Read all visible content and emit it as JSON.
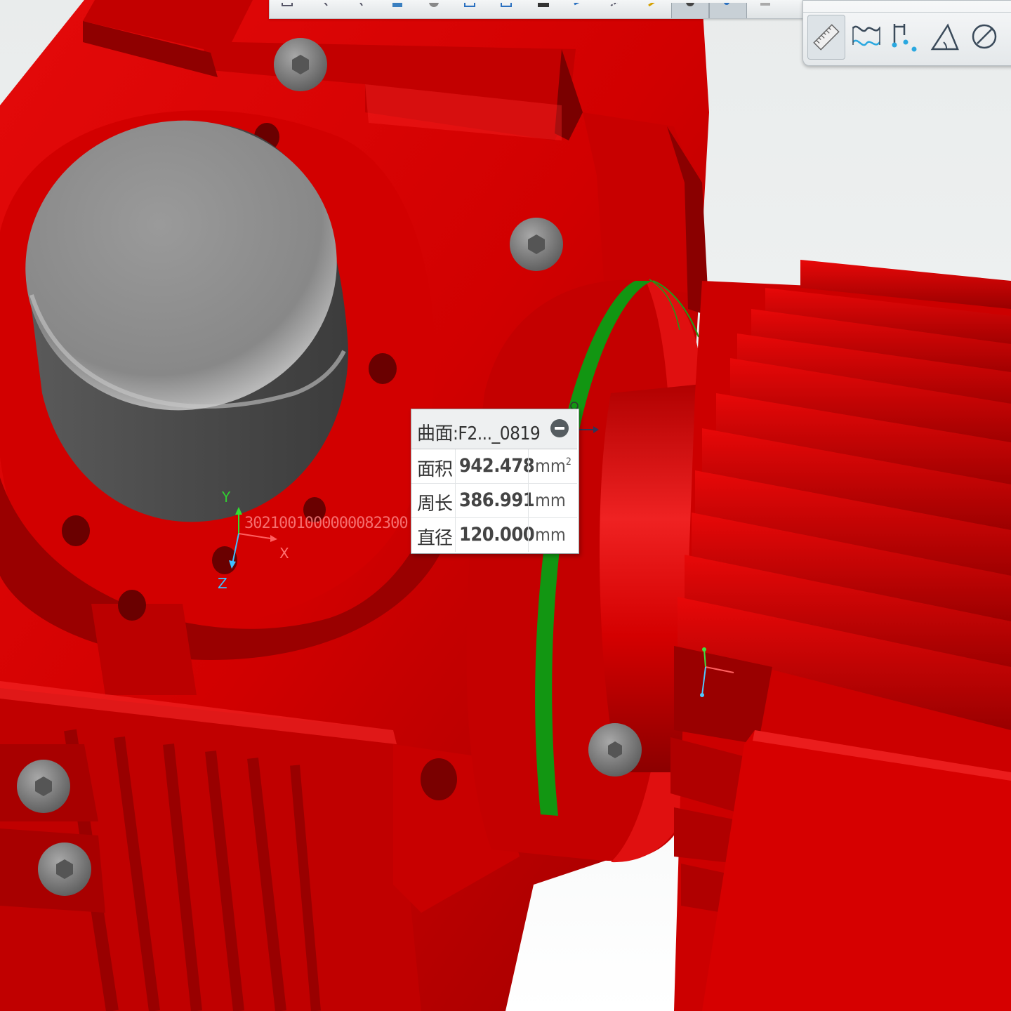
{
  "toolbar": {
    "buttons": [
      {
        "icon": "select-filter-icon"
      },
      {
        "icon": "pick-point-icon"
      },
      {
        "icon": "pick-edge-icon"
      },
      {
        "icon": "render-mode-icon"
      },
      {
        "icon": "shading-icon"
      },
      {
        "icon": "view-box-icon"
      },
      {
        "icon": "view-fit-icon"
      },
      {
        "icon": "camera-icon"
      },
      {
        "icon": "rotate-view-icon"
      },
      {
        "icon": "section-view-icon"
      },
      {
        "icon": "light-icon"
      },
      {
        "icon": "display-toggle-icon",
        "active": true
      },
      {
        "icon": "point-display-icon",
        "active": true
      },
      {
        "icon": "more-icon"
      }
    ]
  },
  "measure_panel": {
    "tools": [
      {
        "icon": "ruler-measure-icon",
        "selected": true
      },
      {
        "icon": "curve-measure-icon"
      },
      {
        "icon": "distance-measure-icon"
      },
      {
        "icon": "angle-measure-icon"
      },
      {
        "icon": "diameter-measure-icon"
      }
    ]
  },
  "info_popup": {
    "title": "曲面:F2..._0819",
    "rows": [
      {
        "label": "面积",
        "value": "942.478",
        "unit": "mm",
        "unit_sup": "2"
      },
      {
        "label": "周长",
        "value": "386.991",
        "unit": "mm",
        "unit_sup": ""
      },
      {
        "label": "直径",
        "value": "120.000",
        "unit": "mm",
        "unit_sup": ""
      }
    ]
  },
  "axis_triad": {
    "x_label": "X",
    "y_label": "Y",
    "z_label": "Z",
    "garbled_text": "3021001000000082300"
  },
  "colors": {
    "part_red": "#d40000",
    "part_dark_red": "#8a0000",
    "cap_gray": "#8a8a8a",
    "highlight_green": "#109010",
    "background": "#eef0f0"
  }
}
